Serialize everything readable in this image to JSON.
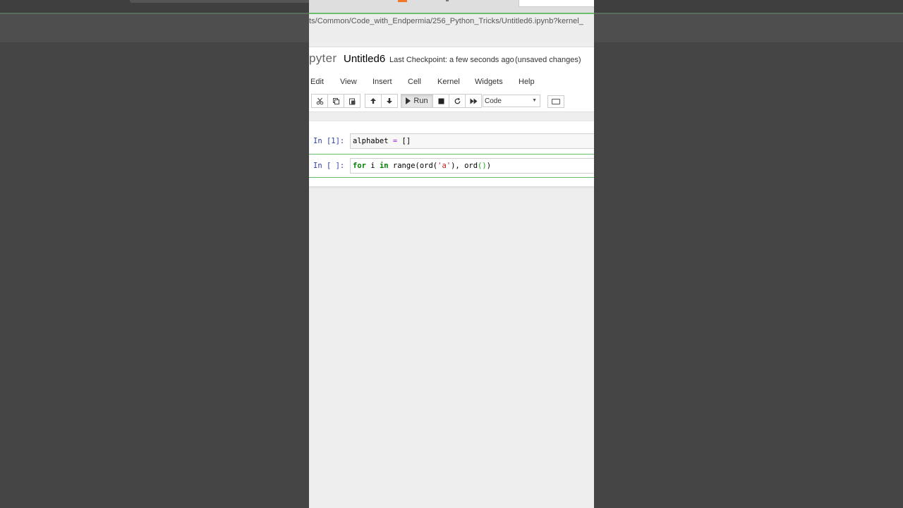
{
  "browser": {
    "url_text": "ts/Common/Code_with_Endpermia/256_Python_Tricks/Untitled6.ipynb?kernel_"
  },
  "header": {
    "logo_text": "pyter",
    "notebook_name": "Untitled6",
    "checkpoint": "Last Checkpoint: a few seconds ago",
    "status": "(unsaved changes)"
  },
  "menu": {
    "items": [
      "Edit",
      "View",
      "Insert",
      "Cell",
      "Kernel",
      "Widgets",
      "Help"
    ]
  },
  "toolbar": {
    "run_label": "Run",
    "cell_type": "Code",
    "icons": [
      "cut-icon",
      "copy-icon",
      "paste-icon",
      "move-up-icon",
      "move-down-icon",
      "run-icon",
      "stop-icon",
      "restart-icon",
      "fast-forward-icon",
      "keyboard-icon"
    ]
  },
  "cells": [
    {
      "prompt": "In [1]:",
      "code": [
        "alphabet ",
        "=",
        " []"
      ]
    },
    {
      "prompt": "In [ ]:",
      "code": [
        "for",
        " i ",
        "in",
        " range(ord(",
        "'a'",
        "), ord",
        "()",
        ")"
      ]
    }
  ],
  "colors": {
    "background": "#454545",
    "prompt": "#303f9f",
    "keyword": "#008000",
    "operator": "#aa22ff",
    "string": "#ba2121",
    "edit_border": "#66bb6a"
  }
}
